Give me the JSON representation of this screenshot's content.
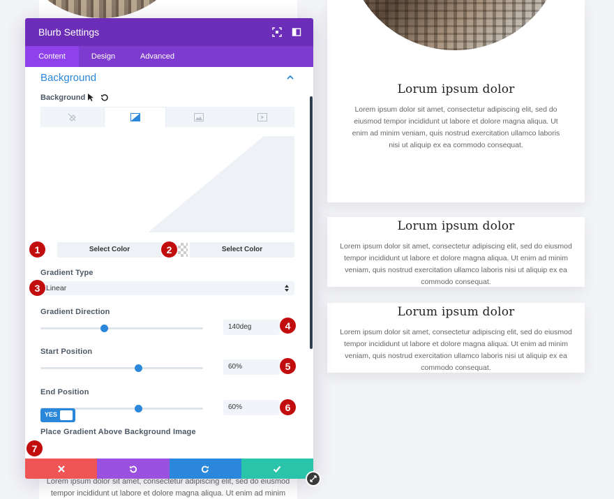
{
  "page": {
    "left_text": "Lorem ipsum dolor sit amet, consectetur adipiscing elit, sed do eiusmod tempor incididunt ut labore et dolore magna aliqua. Ut enim ad minim",
    "cards": [
      {
        "title": "Lorum ipsum dolor",
        "text": "Lorem ipsum dolor sit amet, consectetur adipiscing elit, sed do eiusmod tempor incididunt ut labore et dolore magna aliqua. Ut enim ad minim veniam, quis nostrud exercitation ullamco laboris nisi ut aliquip ex ea commodo consequat."
      },
      {
        "title": "Lorum ipsum dolor",
        "text": "Lorem ipsum dolor sit amet, consectetur adipiscing elit, sed do eiusmod tempor incididunt ut labore et dolore magna aliqua. Ut enim ad minim veniam, quis nostrud exercitation ullamco laboris nisi ut aliquip ex ea commodo consequat."
      },
      {
        "title": "Lorum ipsum dolor",
        "text": "Lorem ipsum dolor sit amet, consectetur adipiscing elit, sed do eiusmod tempor incididunt ut labore et dolore magna aliqua. Ut enim ad minim veniam, quis nostrud exercitation ullamco laboris nisi ut aliquip ex ea commodo consequat."
      }
    ]
  },
  "panel": {
    "title": "Blurb Settings",
    "tabs": [
      {
        "label": "Content",
        "active": true
      },
      {
        "label": "Design",
        "active": false
      },
      {
        "label": "Advanced",
        "active": false
      }
    ],
    "section_title": "Background",
    "background_label": "Background",
    "bg_type_icons": [
      "no-fill-icon",
      "gradient-icon",
      "image-icon",
      "video-icon"
    ],
    "color_buttons": {
      "first": "Select Color",
      "second": "Select Color"
    },
    "gradient_type": {
      "label": "Gradient Type",
      "value": "Linear"
    },
    "gradient_direction": {
      "label": "Gradient Direction",
      "value": "140deg",
      "level": 0.39
    },
    "start_position": {
      "label": "Start Position",
      "value": "60%",
      "level": 0.6
    },
    "end_position": {
      "label": "End Position",
      "value": "60%",
      "level": 0.6
    },
    "gradient_above": {
      "label": "Place Gradient Above Background Image",
      "toggle": "YES"
    },
    "badges": [
      "1",
      "2",
      "3",
      "4",
      "5",
      "6",
      "7"
    ]
  },
  "colors": {
    "header": "#6c2eb9",
    "tabs": "#7e3bd0",
    "accent": "#2b87da",
    "badge": "#c10d0d",
    "cancel": "#ef5555",
    "undo": "#9b51e0",
    "redo": "#2b87da",
    "save": "#29c4a9"
  }
}
